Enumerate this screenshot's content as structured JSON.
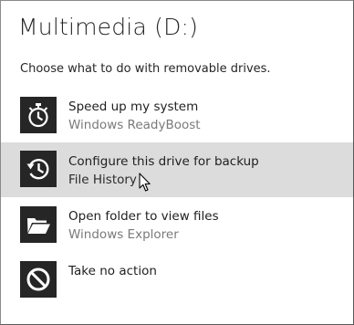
{
  "dialog": {
    "title": "Multimedia (D:)",
    "prompt": "Choose what to do with removable drives."
  },
  "options": [
    {
      "label": "Speed up my system",
      "sublabel": "Windows ReadyBoost",
      "icon": "stopwatch-icon"
    },
    {
      "label": "Configure this drive for backup",
      "sublabel": "File History",
      "icon": "history-clock-icon",
      "state": "hovered"
    },
    {
      "label": "Open folder to view files",
      "sublabel": "Windows Explorer",
      "icon": "folder-open-icon"
    },
    {
      "label": "Take no action",
      "icon": "no-action-icon"
    }
  ],
  "colors": {
    "tile": "#262626",
    "hover_bg": "#dcdcdc",
    "sublabel": "#7a7a7a"
  }
}
